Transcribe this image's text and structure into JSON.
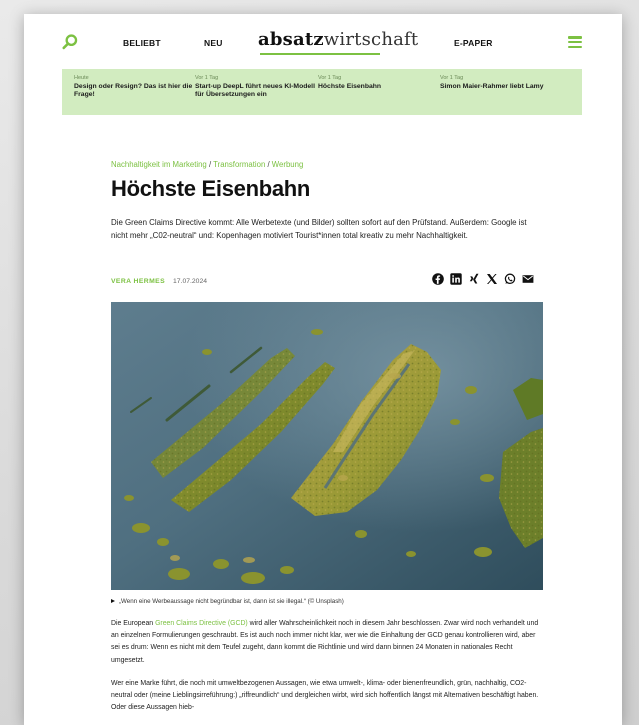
{
  "header": {
    "nav_beliebt": "BELIEBT",
    "nav_neu": "NEU",
    "logo_bold": "absatz",
    "logo_light": "wirtschaft",
    "nav_epaper": "E-PAPER",
    "search_icon": "search-icon",
    "menu_icon": "hamburger-menu-icon"
  },
  "ticker": [
    {
      "date": "Heute",
      "title": "Design oder Resign? Das ist hier die Frage!"
    },
    {
      "date": "Vor 1 Tag",
      "title": "Start-up DeepL führt neues KI-Modell für Übersetzungen ein"
    },
    {
      "date": "Vor 1 Tag",
      "title": "Höchste Eisenbahn"
    },
    {
      "date": "Vor 1 Tag",
      "title": "Simon Maier-Rahmer liebt Lamy"
    }
  ],
  "article": {
    "breadcrumb": {
      "c1": "Nachhaltigkeit im Marketing",
      "c2": "Transformation",
      "c3": "Werbung",
      "sep": " / "
    },
    "title": "Höchste Eisenbahn",
    "lead": "Die Green Claims Directive kommt: Alle Werbetexte (und Bilder) sollten sofort auf den Prüfstand. Außerdem: Google ist nicht mehr „C02-neutral“ und: Kopenhagen motiviert Tourist*innen total kreativ zu mehr Nachhaltigkeit.",
    "author": "VERA HERMES",
    "date": "17.07.2024",
    "share_icons": [
      "facebook-icon",
      "linkedin-icon",
      "xing-icon",
      "x-icon",
      "whatsapp-icon",
      "mail-icon"
    ],
    "caption": "„Wenn eine Werbeaussage nicht begründbar ist, dann ist sie illegal.“ (© Unsplash)",
    "p1_before": "Die European ",
    "p1_link": "Green Claims Directive (GCD)",
    "p1_after": " wird aller Wahrscheinlichkeit noch in diesem Jahr beschlossen. Zwar wird noch verhandelt und an einzelnen Formulierungen geschraubt. Es ist auch noch immer nicht klar, wer wie die Einhaltung der GCD genau kontrollieren wird, aber sei es drum: Wenn es nicht mit dem Teufel zugeht, dann kommt die Richtlinie und wird dann binnen 24 Monaten in nationales Recht umgesetzt.",
    "p2": "Wer eine Marke führt, die noch mit umweltbezogenen Aussagen, wie etwa umwelt-, klima- oder bienenfreundlich, grün, nachhaltig, CO2-neutral oder (meine Lieblingsirreführung:) „riffreundlich“ und dergleichen wirbt, wird sich hoffentlich längst mit Alternativen beschäftigt haben. Oder diese Aussagen hieb-"
  },
  "colors": {
    "accent": "#7cc142",
    "ticker_bg": "#d2ecc0",
    "text": "#111111"
  }
}
